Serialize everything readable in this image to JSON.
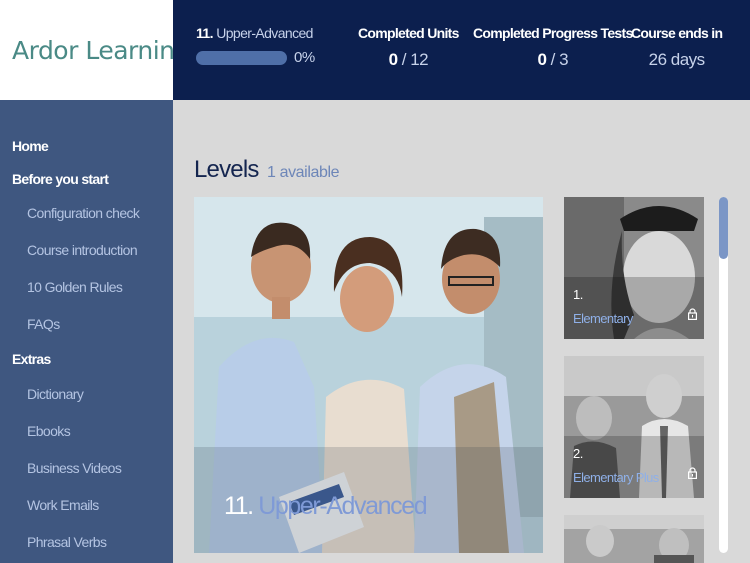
{
  "brand": {
    "name": "Ardor Learning"
  },
  "header": {
    "current_level_number": "11.",
    "current_level_name": "Upper-Advanced",
    "progress_percent_label": "0%",
    "progress_fraction": 0,
    "completed_units": {
      "label": "Completed Units",
      "current": "0",
      "separator": " / ",
      "total": "12"
    },
    "completed_tests": {
      "label": "Completed Progress Tests",
      "current": "0",
      "separator": " / ",
      "total": "3"
    },
    "course_ends": {
      "label": "Course ends in",
      "value": "26 days"
    }
  },
  "sidebar": {
    "home": "Home",
    "before_section": "Before you start",
    "before_items": [
      "Configuration check",
      "Course introduction",
      "10 Golden Rules",
      "FAQs"
    ],
    "extras_section": "Extras",
    "extras_items": [
      "Dictionary",
      "Ebooks",
      "Business Videos",
      "Work Emails",
      "Phrasal Verbs"
    ]
  },
  "main": {
    "levels_title": "Levels",
    "levels_count": "1 available",
    "featured": {
      "number": "11.",
      "name": "Upper-Advanced"
    },
    "thumbnails": [
      {
        "number": "1.",
        "name": "Elementary",
        "locked": true
      },
      {
        "number": "2.",
        "name": "Elementary Plus",
        "locked": true
      }
    ]
  },
  "colors": {
    "header_bg": "#0c1f4e",
    "sidebar_bg": "#3f5780",
    "accent": "#7d98c8",
    "brand_text": "#4a8a86"
  },
  "icons": {
    "logo": "globe-icon",
    "lock": "lock-icon"
  }
}
